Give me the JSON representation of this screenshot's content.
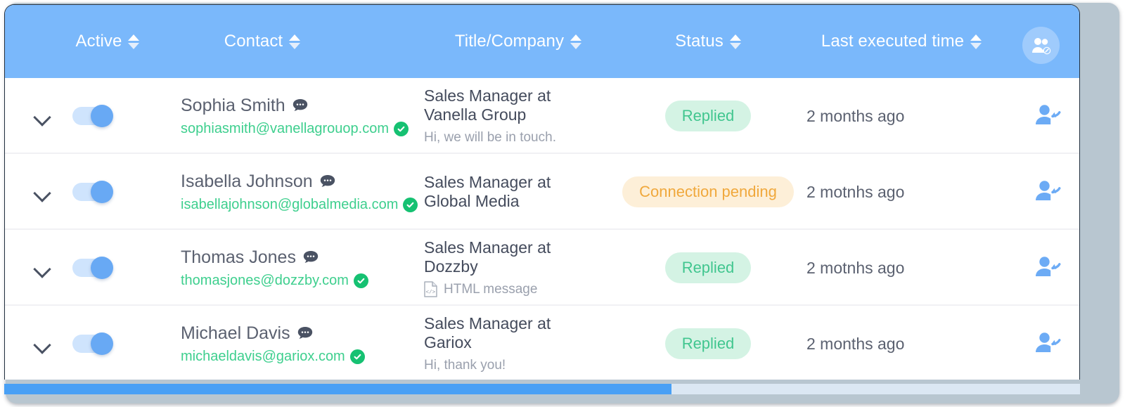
{
  "table": {
    "columns": [
      {
        "key": "active",
        "label": "Active",
        "sortable": true
      },
      {
        "key": "contact",
        "label": "Contact",
        "sortable": true
      },
      {
        "key": "title",
        "label": "Title/Company",
        "sortable": true
      },
      {
        "key": "status",
        "label": "Status",
        "sortable": true
      },
      {
        "key": "time",
        "label": "Last executed time",
        "sortable": true
      }
    ],
    "header_action_icon": "group-edit-icon",
    "rows": [
      {
        "expand_icon": "chevron-down-icon",
        "active": true,
        "name": "Sophia Smith",
        "name_icon": "chat-bubble-icon",
        "email": "sophiasmith@vanellagrouop.com",
        "email_verified": true,
        "title": "Sales Manager at Vanella Group",
        "subtitle": "Hi, we will be in touch.",
        "subtitle_icon": "",
        "status": "Replied",
        "status_type": "replied",
        "time": "2 months ago",
        "action_icon": "person-reply-icon"
      },
      {
        "expand_icon": "chevron-down-icon",
        "active": true,
        "name": "Isabella Johnson",
        "name_icon": "chat-bubble-icon",
        "email": "isabellajohnson@globalmedia.com",
        "email_verified": true,
        "title": "Sales Manager at Global Media",
        "subtitle": "",
        "subtitle_icon": "",
        "status": "Connection pending",
        "status_type": "pending",
        "time": "2 motnhs ago",
        "action_icon": "person-reply-icon"
      },
      {
        "expand_icon": "chevron-down-icon",
        "active": true,
        "name": "Thomas Jones",
        "name_icon": "chat-bubble-icon",
        "email": "thomasjones@dozzby.com",
        "email_verified": true,
        "title": "Sales Manager at Dozzby",
        "subtitle": "HTML message",
        "subtitle_icon": "html-file-icon",
        "status": "Replied",
        "status_type": "replied",
        "time": "2 motnhs ago",
        "action_icon": "person-reply-icon"
      },
      {
        "expand_icon": "chevron-down-icon",
        "active": true,
        "name": "Michael Davis",
        "name_icon": "chat-bubble-icon",
        "email": "michaeldavis@gariox.com",
        "email_verified": true,
        "title": "Sales Manager at Gariox",
        "subtitle": "Hi, thank you!",
        "subtitle_icon": "",
        "status": "Replied",
        "status_type": "replied",
        "time": "2 months ago",
        "action_icon": "person-reply-icon"
      }
    ]
  },
  "scrollbar": {
    "orientation": "horizontal",
    "thumb_percent": 62
  },
  "colors": {
    "header_blue": "#7ab8fb",
    "toggle_on": "#68a9f4",
    "email_green": "#3ecf8e",
    "verified_green": "#16c172",
    "badge_replied_bg": "#d4f3e4",
    "badge_replied_text": "#41c68f",
    "badge_pending_bg": "#fdefd8",
    "badge_pending_text": "#f0a83c",
    "scroll_thumb": "#49a0f5"
  }
}
